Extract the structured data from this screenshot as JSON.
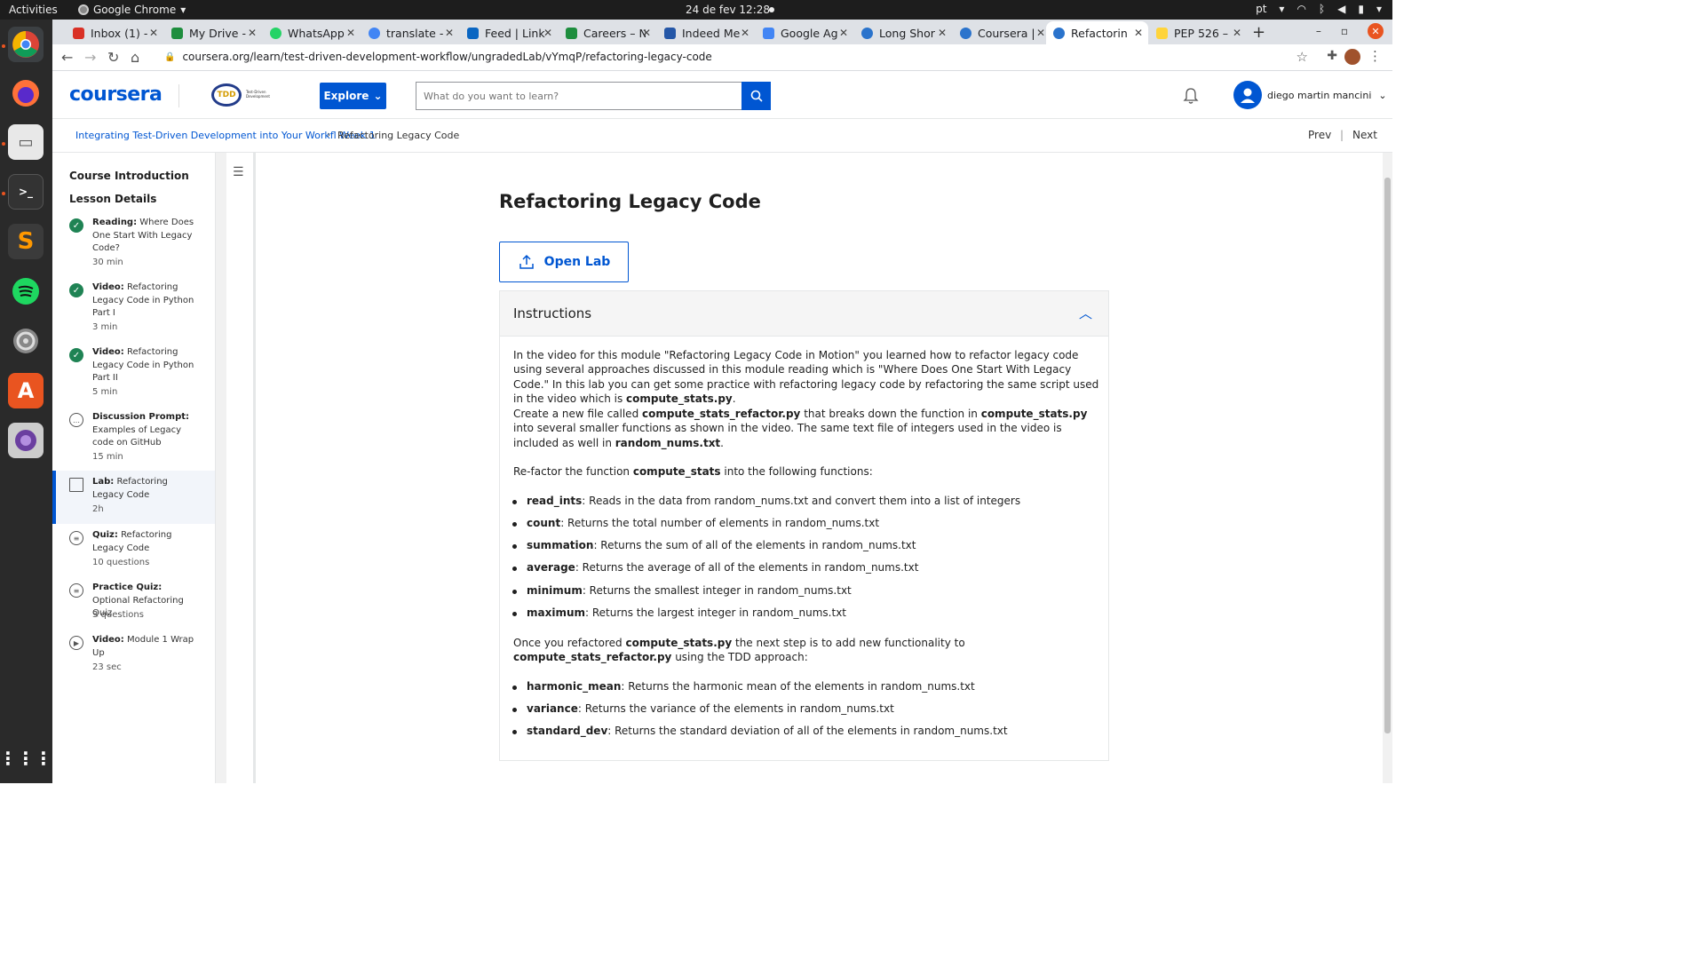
{
  "os": {
    "activities": "Activities",
    "app_name": "Google Chrome",
    "clock": "24 de fev  12:28",
    "lang": "pt"
  },
  "tabs": [
    {
      "label": "Inbox (1) -",
      "color": "#d93025"
    },
    {
      "label": "My Drive -",
      "color": "#1e8e3e"
    },
    {
      "label": "WhatsApp",
      "color": "#25d366"
    },
    {
      "label": "translate -",
      "color": "#4285f4"
    },
    {
      "label": "Feed | Link",
      "color": "#0a66c2"
    },
    {
      "label": "Careers – N",
      "color": "#1e8e3e"
    },
    {
      "label": "Indeed Me",
      "color": "#2557a7"
    },
    {
      "label": "Google Ag",
      "color": "#4285f4"
    },
    {
      "label": "Long Shor",
      "color": "#2a73cc"
    },
    {
      "label": "Coursera |",
      "color": "#2a73cc"
    },
    {
      "label": "Refactorin",
      "color": "#2a73cc"
    },
    {
      "label": "PEP 526 –",
      "color": "#ffd43b"
    }
  ],
  "address": {
    "url": "coursera.org/learn/test-driven-development-workflow/ungradedLab/vYmqP/refactoring-legacy-code"
  },
  "header": {
    "logo": "coursera",
    "tdd_logo": "TDD",
    "tdd_sub": "Test-Driven Development",
    "explore": "Explore",
    "search_placeholder": "What do you want to learn?",
    "username": "diego martin mancini"
  },
  "breadcrumb": {
    "course": "Integrating Test-Driven Development into Your Workfl Week 1",
    "current": "Refactoring Legacy Code",
    "prev": "Prev",
    "divider": "|",
    "next": "Next"
  },
  "sidebar": {
    "course_intro": "Course Introduction",
    "lesson_details": "Lesson Details",
    "items": [
      {
        "type": "Reading:",
        "title": "Where Does One Start With Legacy Code?",
        "duration": "30 min",
        "status": "done"
      },
      {
        "type": "Video:",
        "title": "Refactoring Legacy Code in Python Part I",
        "duration": "3 min",
        "status": "done"
      },
      {
        "type": "Video:",
        "title": "Refactoring Legacy Code in Python Part II",
        "duration": "5 min",
        "status": "done"
      },
      {
        "type": "Discussion Prompt:",
        "title": "Examples of Legacy code on GitHub",
        "duration": "15 min",
        "status": "todo"
      },
      {
        "type": "Lab:",
        "title": "Refactoring Legacy Code",
        "duration": "2h",
        "status": "active"
      },
      {
        "type": "Quiz:",
        "title": "Refactoring Legacy Code",
        "duration": "10 questions",
        "status": "todo"
      },
      {
        "type": "Practice Quiz:",
        "title": "Optional Refactoring Quiz",
        "duration": "3 questions",
        "status": "todo"
      },
      {
        "type": "Video:",
        "title": "Module 1 Wrap Up",
        "duration": "23 sec",
        "status": "todo"
      }
    ]
  },
  "main": {
    "title": "Refactoring Legacy Code",
    "open_lab": "Open Lab",
    "instructions_title": "Instructions",
    "p1": {
      "a": "In the video for this module \"Refactoring Legacy Code in Motion\" you learned how to refactor legacy code using several approaches discussed in this module reading which is \"Where Does One Start With Legacy Code.\" In this lab you can get some practice with refactoring legacy code by refactoring the same script used in the video which is ",
      "b": "compute_stats.py",
      "c": "."
    },
    "p2": {
      "a": "Create a new file called ",
      "b": "compute_stats_refactor.py",
      "c": " that breaks down the function in ",
      "d": "compute_stats.py",
      "e": " into several smaller functions as shown in the video. The same text file of integers used in the video is included as well in ",
      "f": "random_nums.txt",
      "g": "."
    },
    "p3": {
      "a": "Re-factor the function ",
      "b": "compute_stats",
      "c": " into the following functions:"
    },
    "functions": [
      {
        "name": "read_ints",
        "desc": ": Reads in the data from random_nums.txt and convert them into a list of integers"
      },
      {
        "name": "count",
        "desc": ": Returns the total number of elements in random_nums.txt"
      },
      {
        "name": "summation",
        "desc": ": Returns the sum of all of the elements in random_nums.txt"
      },
      {
        "name": "average",
        "desc": ": Returns the average of all of the elements in random_nums.txt"
      },
      {
        "name": "minimum",
        "desc": ": Returns the smallest integer in random_nums.txt"
      },
      {
        "name": "maximum",
        "desc": ": Returns the largest integer in random_nums.txt"
      }
    ],
    "p4": {
      "a": "Once you refactored ",
      "b": "compute_stats.py",
      "c": " the next step is to add new functionality to ",
      "d": "compute_stats_refactor.py",
      "e": " using the TDD approach:"
    },
    "new_functions": [
      {
        "name": "harmonic_mean",
        "desc": ": Returns the harmonic mean of the elements in random_nums.txt"
      },
      {
        "name": "variance",
        "desc": ": Returns the variance of the elements in random_nums.txt"
      },
      {
        "name": "standard_dev",
        "desc": ": Returns the standard deviation of all of the elements in random_nums.txt"
      }
    ]
  }
}
